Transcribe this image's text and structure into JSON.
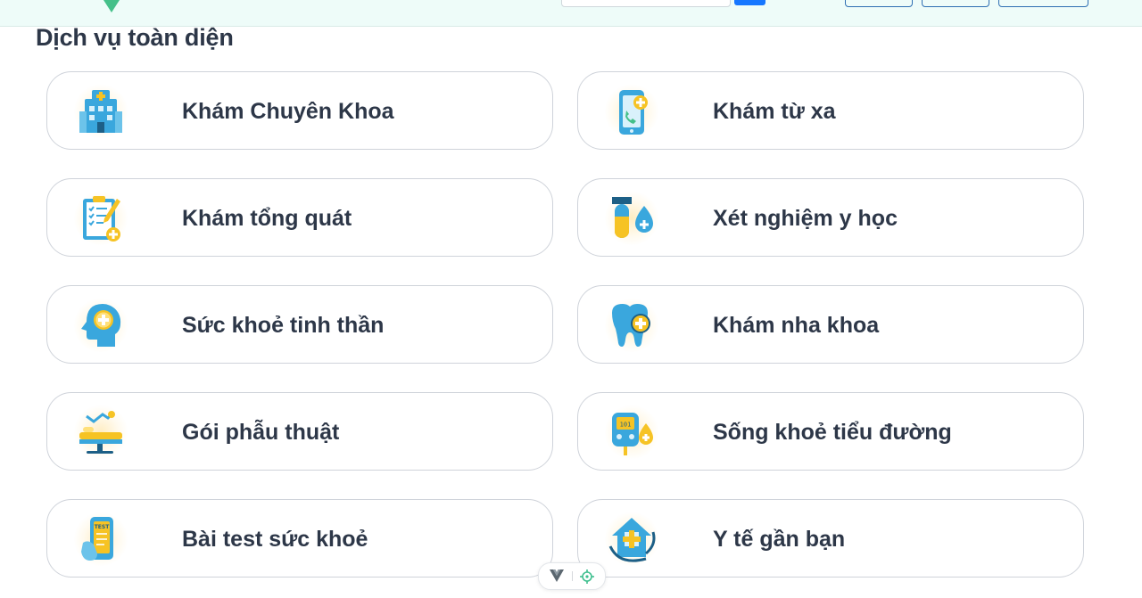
{
  "section": {
    "title": "Dịch vụ toàn diện"
  },
  "services": [
    {
      "label": "Khám Chuyên Khoa",
      "icon": "hospital-icon"
    },
    {
      "label": "Khám từ xa",
      "icon": "telemedicine-phone-icon"
    },
    {
      "label": "Khám tổng quát",
      "icon": "checklist-clipboard-icon"
    },
    {
      "label": "Xét nghiệm y học",
      "icon": "test-tube-drop-icon"
    },
    {
      "label": "Sức khoẻ tinh thần",
      "icon": "mental-health-head-icon"
    },
    {
      "label": "Khám nha khoa",
      "icon": "tooth-icon"
    },
    {
      "label": "Gói phẫu thuật",
      "icon": "surgery-table-icon"
    },
    {
      "label": "Sống khoẻ tiểu đường",
      "icon": "glucose-meter-icon"
    },
    {
      "label": "Bài test sức khoẻ",
      "icon": "health-test-phone-icon"
    },
    {
      "label": "Y tế gần bạn",
      "icon": "nearby-clinic-home-icon"
    }
  ],
  "colors": {
    "accent_blue": "#1677ff",
    "icon_blue": "#3aa7dd",
    "icon_yellow": "#f6c324",
    "text": "#2d3748",
    "card_border": "#cfd3da",
    "topbar_bg": "#eefcf9"
  }
}
